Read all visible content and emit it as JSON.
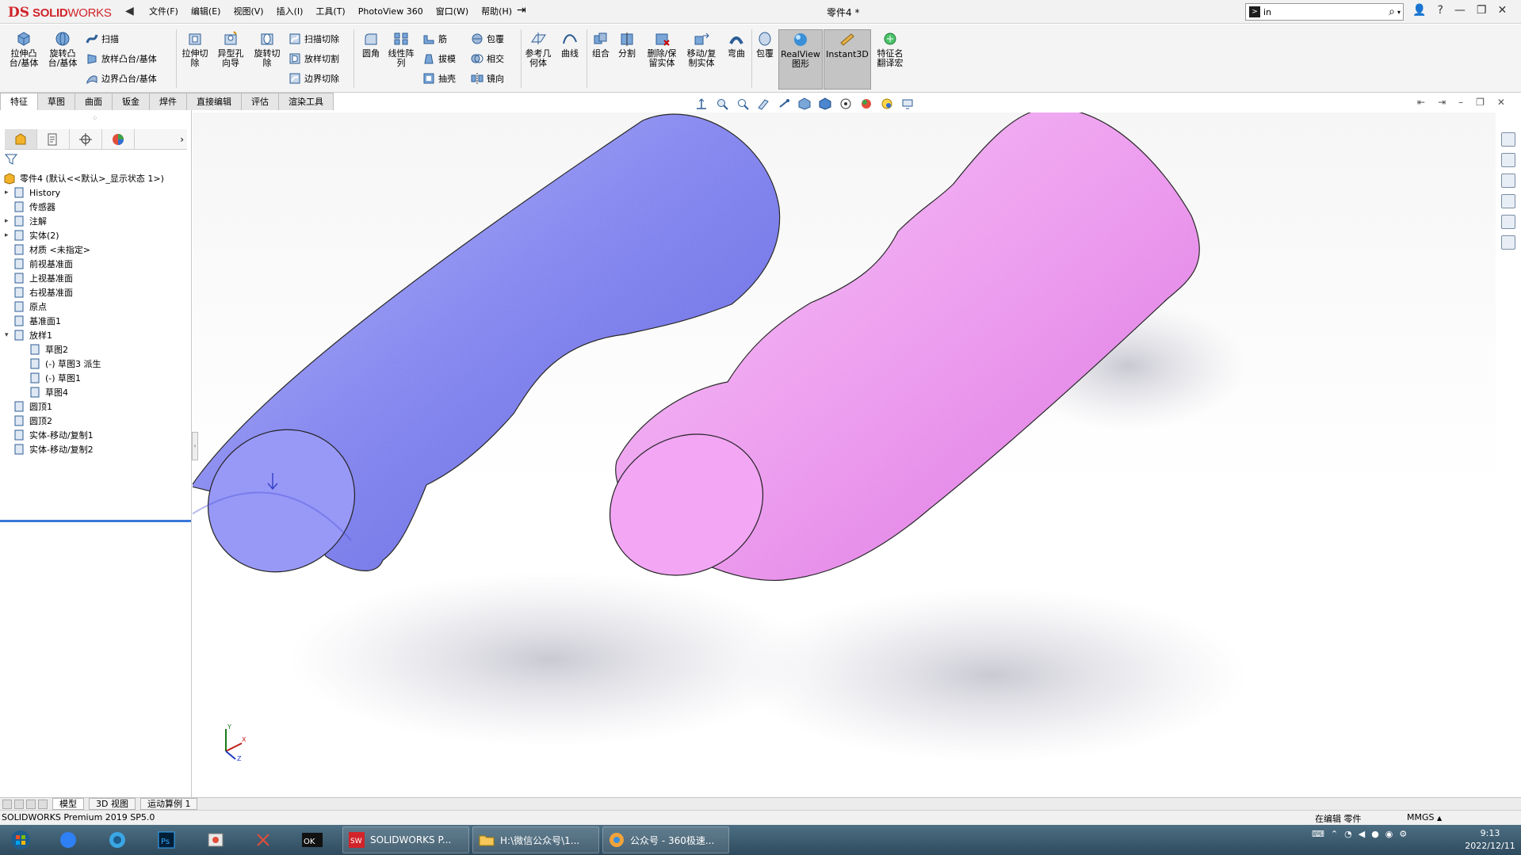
{
  "titlebar": {
    "brand_ds": "DS",
    "brand_name_bold": "SOLID",
    "brand_name_thin": "WORKS",
    "doc_title": "零件4 *",
    "search_value": "in",
    "menus": [
      "文件(F)",
      "编辑(E)",
      "视图(V)",
      "插入(I)",
      "工具(T)",
      "PhotoView 360",
      "窗口(W)",
      "帮助(H)"
    ]
  },
  "features": {
    "extrude_boss": "拉伸凸\n台/基体",
    "revolve_boss": "旋转凸\n台/基体",
    "sweep": "扫描",
    "loft_boss": "放样凸台/基体",
    "boundary_boss": "边界凸台/基体",
    "extrude_cut": "拉伸切\n除",
    "hole_wizard": "异型孔\n向导",
    "revolve_cut": "旋转切\n除",
    "swept_cut": "扫描切除",
    "lofted_cut": "放样切割",
    "boundary_cut": "边界切除",
    "fillet": "圆角",
    "linear_pattern": "线性阵\n列",
    "rib": "筋",
    "draft": "拔模",
    "shell": "抽壳",
    "wrap": "包覆",
    "intersect": "相交",
    "mirror": "镜向",
    "ref_geometry": "参考几\n何体",
    "curves": "曲线",
    "combine": "组合",
    "split": "分割",
    "delete_keep_body": "删除/保\n留实体",
    "move_copy_body": "移动/复\n制实体",
    "flex": "弯曲",
    "wrap2": "包覆",
    "realview": "RealView\n图形",
    "instant3d": "Instant3D",
    "feature_translate": "特征名\n翻译宏"
  },
  "cm_tabs": [
    "特征",
    "草图",
    "曲面",
    "钣金",
    "焊件",
    "直接编辑",
    "评估",
    "渲染工具"
  ],
  "tree": {
    "root": "零件4 (默认<<默认>_显示状态 1>)",
    "items": [
      {
        "label": "History",
        "arrow": "▸",
        "indent": 0
      },
      {
        "label": "传感器",
        "arrow": "",
        "indent": 0
      },
      {
        "label": "注解",
        "arrow": "▸",
        "indent": 0
      },
      {
        "label": "实体(2)",
        "arrow": "▸",
        "indent": 0
      },
      {
        "label": "材质 <未指定>",
        "arrow": "",
        "indent": 0
      },
      {
        "label": "前视基准面",
        "arrow": "",
        "indent": 0
      },
      {
        "label": "上视基准面",
        "arrow": "",
        "indent": 0
      },
      {
        "label": "右视基准面",
        "arrow": "",
        "indent": 0
      },
      {
        "label": "原点",
        "arrow": "",
        "indent": 0
      },
      {
        "label": "基准面1",
        "arrow": "",
        "indent": 0
      },
      {
        "label": "放样1",
        "arrow": "▾",
        "indent": 0
      },
      {
        "label": "草图2",
        "arrow": "",
        "indent": 1
      },
      {
        "label": "(-) 草图3 派生",
        "arrow": "",
        "indent": 1
      },
      {
        "label": "(-) 草图1",
        "arrow": "",
        "indent": 1
      },
      {
        "label": "草图4",
        "arrow": "",
        "indent": 1
      },
      {
        "label": "圆顶1",
        "arrow": "",
        "indent": 0
      },
      {
        "label": "圆顶2",
        "arrow": "",
        "indent": 0
      },
      {
        "label": "实体-移动/复制1",
        "arrow": "",
        "indent": 0
      },
      {
        "label": "实体-移动/复制2",
        "arrow": "",
        "indent": 0
      }
    ]
  },
  "bottom_tabs": [
    "模型",
    "3D 视图",
    "运动算例 1"
  ],
  "status": {
    "product": "SOLIDWORKS Premium 2019 SP5.0",
    "editing": "在编辑 零件",
    "units": "MMGS"
  },
  "taskbar": {
    "windows": [
      "SOLIDWORKS P...",
      "H:\\微信公众号\\1...",
      "公众号 - 360极速..."
    ],
    "time": "9:13",
    "date": "2022/12/11"
  },
  "colors": {
    "body1": "#7b7df2",
    "body2": "#f08ef2",
    "accent": "#d1242a"
  }
}
